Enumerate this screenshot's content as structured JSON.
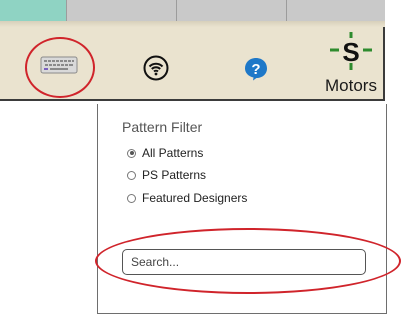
{
  "toolbar": {
    "tabs": [
      "",
      "",
      "",
      ""
    ],
    "tools": {
      "keyboard": {
        "icon": "keyboard-icon"
      },
      "wifi": {
        "icon": "wifi-icon"
      },
      "help": {
        "icon": "help-icon"
      },
      "motors": {
        "icon": "motors-icon",
        "label": "Motors"
      }
    }
  },
  "filter": {
    "title": "Pattern Filter",
    "options": [
      {
        "label": "All Patterns",
        "selected": true
      },
      {
        "label": "PS Patterns",
        "selected": false
      },
      {
        "label": "Featured Designers",
        "selected": false
      }
    ],
    "search": {
      "placeholder": "Search...",
      "value": ""
    }
  },
  "colors": {
    "toolbar_bg": "#eae3cf",
    "active_tab": "#8fd3c3",
    "inactive_tab": "#c9c9c9",
    "highlight": "#d0242b",
    "help_blue": "#1e78c8",
    "motors_green": "#2e8b2e"
  }
}
